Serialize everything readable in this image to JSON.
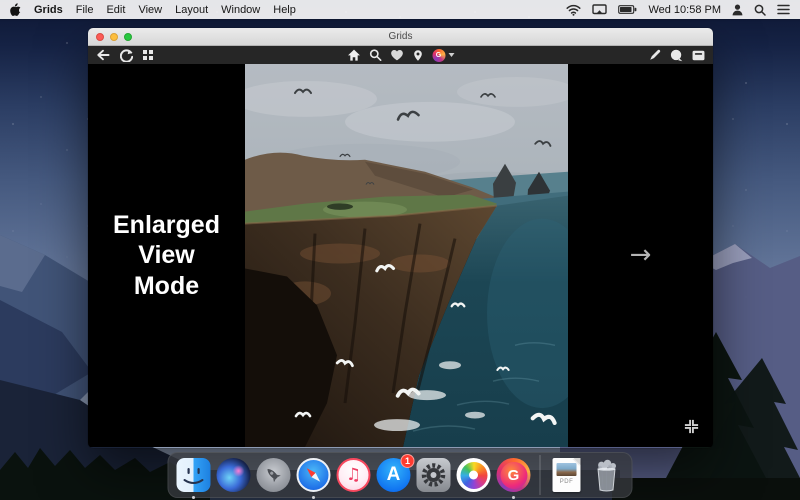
{
  "menu_bar": {
    "items": [
      "Grids",
      "File",
      "Edit",
      "View",
      "Layout",
      "Window",
      "Help"
    ],
    "clock": "Wed 10:58 PM",
    "status_icons": [
      "wifi",
      "display-mirroring",
      "battery",
      "user",
      "spotlight-search",
      "notification-center"
    ]
  },
  "window": {
    "title": "Grids",
    "toolbar": {
      "left_icons": [
        "back",
        "refresh",
        "grid-view"
      ],
      "center_icons": [
        "home",
        "search",
        "likes",
        "locations",
        "account-avatar"
      ],
      "right_icons": [
        "compose",
        "comments",
        "inbox"
      ]
    }
  },
  "content": {
    "mode_lines": [
      "Enlarged",
      "View",
      "Mode"
    ],
    "next_arrow": "→",
    "photo_subject": "coastal cliffs with seagulls over teal ocean"
  },
  "icon_glyphs": {
    "grids_letter": "G",
    "appstore_letter": "A",
    "itunes_note": "♫",
    "pdf_label": "PDF"
  },
  "dock": {
    "items": [
      {
        "name": "Finder",
        "running": true
      },
      {
        "name": "Siri"
      },
      {
        "name": "Launchpad"
      },
      {
        "name": "Safari",
        "running": true
      },
      {
        "name": "iTunes"
      },
      {
        "name": "App Store",
        "badge": "1"
      },
      {
        "name": "System Preferences"
      },
      {
        "name": "Photos"
      },
      {
        "name": "Grids",
        "running": true
      },
      {
        "name": "PDF Document"
      },
      {
        "name": "Trash"
      }
    ]
  },
  "colors": {
    "badge_red": "#ff3b30",
    "traffic_red": "#fc5b57",
    "traffic_yellow": "#fdbe3d",
    "traffic_green": "#28c840",
    "toolbar_bg": "#262626",
    "content_bg": "#000000"
  }
}
